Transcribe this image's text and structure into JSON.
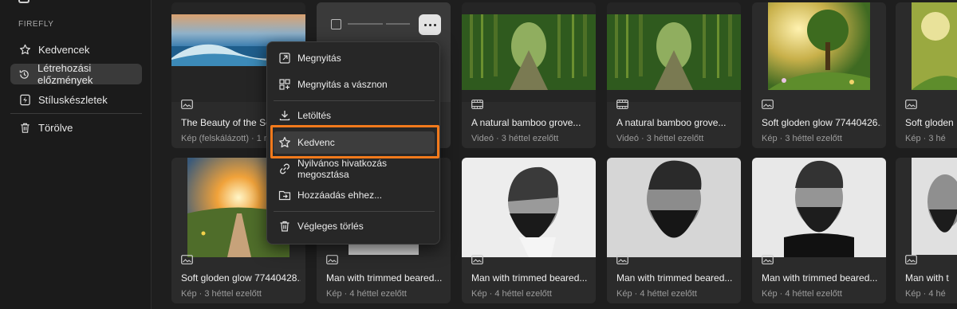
{
  "sidebar": {
    "section_title": "FIREFLY",
    "items": [
      {
        "label": "Kedvencek",
        "icon": "star-icon"
      },
      {
        "label": "Létrehozási előzmények",
        "icon": "history-icon",
        "active": true
      },
      {
        "label": "Stíluskészletek",
        "icon": "lightning-icon"
      },
      {
        "label": "Törölve",
        "icon": "trash-icon"
      }
    ]
  },
  "cards": [
    {
      "title": "The Beauty of the Sea",
      "meta": "Kép (felskálázott) · 1 n",
      "type": "image"
    },
    {
      "title": "",
      "meta": "",
      "type": "image",
      "selected": true
    },
    {
      "title": "A natural bamboo grove...",
      "meta": "Videó · 3 héttel ezelőtt",
      "type": "video"
    },
    {
      "title": "A natural bamboo grove...",
      "meta": "Videó · 3 héttel ezelőtt",
      "type": "video"
    },
    {
      "title": "Soft gloden glow 77440426...",
      "meta": "Kép · 3 héttel ezelőtt",
      "type": "image"
    },
    {
      "title": "Soft gloden",
      "meta": "Kép · 3 hé",
      "type": "image"
    },
    {
      "title": "Soft gloden glow 77440428...",
      "meta": "Kép · 3 héttel ezelőtt",
      "type": "image"
    },
    {
      "title": "Man with trimmed beared...",
      "meta": "Kép · 4 héttel ezelőtt",
      "type": "image"
    },
    {
      "title": "Man with trimmed beared...",
      "meta": "Kép · 4 héttel ezelőtt",
      "type": "image"
    },
    {
      "title": "Man with trimmed beared...",
      "meta": "Kép · 4 héttel ezelőtt",
      "type": "image"
    },
    {
      "title": "Man with trimmed beared...",
      "meta": "Kép · 4 héttel ezelőtt",
      "type": "image"
    },
    {
      "title": "Man with t",
      "meta": "Kép · 4 hé",
      "type": "image"
    }
  ],
  "context_menu": {
    "items": [
      {
        "label": "Megnyitás",
        "icon": "open-icon"
      },
      {
        "label": "Megnyitás a vásznon",
        "icon": "canvas-icon"
      },
      {
        "label": "Letöltés",
        "icon": "download-icon"
      },
      {
        "label": "Kedvenc",
        "icon": "star-icon",
        "highlighted": true
      },
      {
        "label": "Nyilvános hivatkozás megosztása",
        "icon": "link-icon"
      },
      {
        "label": "Hozzáadás ehhez...",
        "icon": "folder-add-icon"
      },
      {
        "label": "Végleges törlés",
        "icon": "trash-icon"
      }
    ]
  },
  "colors": {
    "highlight_outline": "#f27a1c",
    "background": "#1e1e1e",
    "card": "#2b2b2b"
  }
}
